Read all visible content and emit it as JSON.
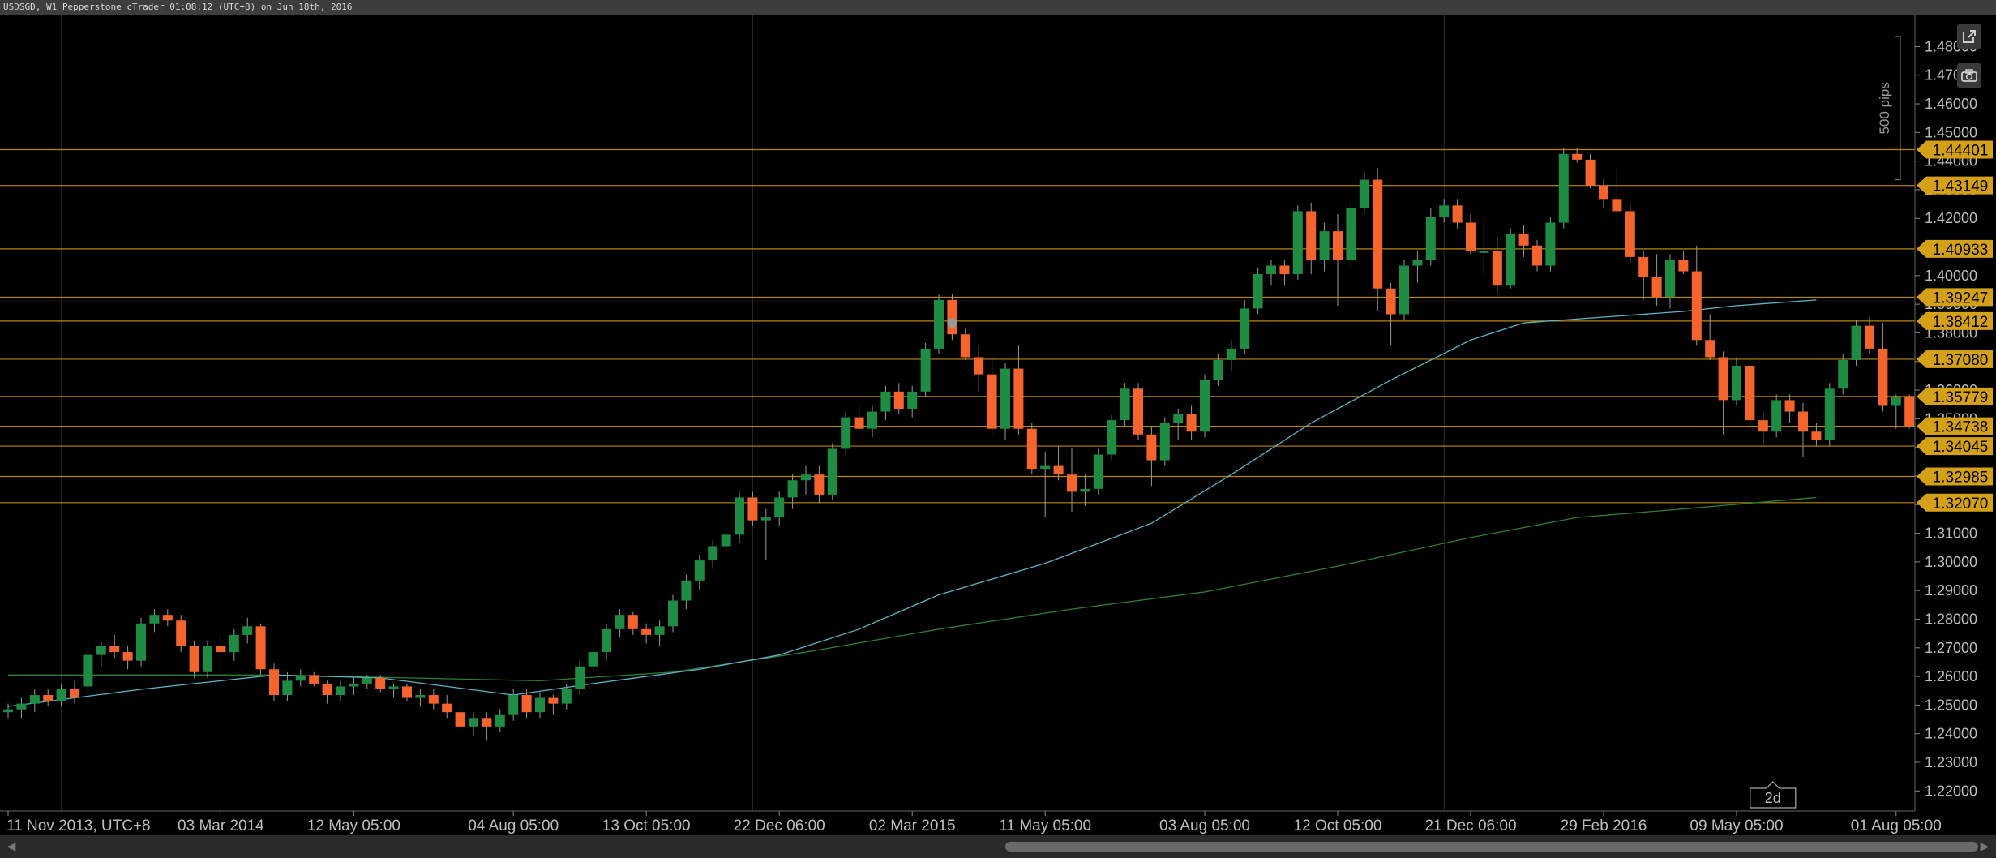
{
  "window": {
    "title": "USDSGD, W1 Pepperstone cTrader 01:08:12 (UTC+8) on Jun 18th, 2016"
  },
  "toolbar": {
    "detach_icon": "external-link-icon",
    "screenshot_icon": "camera-icon"
  },
  "colors": {
    "background": "#000000",
    "bull_candle": "#1e8c43",
    "bear_candle": "#f4642c",
    "horizontal_line": "#b8860b",
    "price_tag": "#d4a017",
    "ma_fast": "#5fb3c7",
    "ma_slow": "#2e7d32",
    "axis_text": "#bdbdbd"
  },
  "chart_data": {
    "type": "candlestick",
    "symbol": "USDSGD",
    "timeframe": "W1",
    "ylim": [
      1.213,
      1.4855
    ],
    "y_ticks": [
      1.22,
      1.23,
      1.24,
      1.25,
      1.26,
      1.27,
      1.28,
      1.29,
      1.3,
      1.31,
      1.32,
      1.33,
      1.34,
      1.35,
      1.36,
      1.37,
      1.38,
      1.39,
      1.4,
      1.41,
      1.42,
      1.43,
      1.44,
      1.45,
      1.46,
      1.47,
      1.48
    ],
    "y_tick_labels": [
      "1.22000",
      "1.23000",
      "1.24000",
      "1.25000",
      "1.26000",
      "1.27000",
      "1.28000",
      "1.29000",
      "1.30000",
      "1.31000",
      "1.32000",
      "1.33000",
      "1.34000",
      "1.35000",
      "1.36000",
      "1.37000",
      "1.38000",
      "1.39000",
      "1.40000",
      "1.41000",
      "1.42000",
      "1.43000",
      "1.44000",
      "1.45000",
      "1.46000",
      "1.47000",
      "1.48000"
    ],
    "x_labels": [
      {
        "index": 0,
        "label": "11 Nov 2013, UTC+8"
      },
      {
        "index": 16,
        "label": "03 Mar 2014"
      },
      {
        "index": 26,
        "label": "12 May 05:00"
      },
      {
        "index": 38,
        "label": "04 Aug 05:00"
      },
      {
        "index": 48,
        "label": "13 Oct 05:00"
      },
      {
        "index": 58,
        "label": "22 Dec 06:00"
      },
      {
        "index": 68,
        "label": "02 Mar 2015"
      },
      {
        "index": 78,
        "label": "11 May 05:00"
      },
      {
        "index": 90,
        "label": "03 Aug 05:00"
      },
      {
        "index": 100,
        "label": "12 Oct 05:00"
      },
      {
        "index": 110,
        "label": "21 Dec 06:00"
      },
      {
        "index": 120,
        "label": "29 Feb 2016"
      },
      {
        "index": 130,
        "label": "09 May 05:00"
      },
      {
        "index": 142,
        "label": "01 Aug 05:00"
      }
    ],
    "vertical_gridline_indices": [
      4,
      56,
      108
    ],
    "candles": [
      [
        1.2475,
        1.2505,
        1.2455,
        1.2485
      ],
      [
        1.2485,
        1.2525,
        1.2455,
        1.2505
      ],
      [
        1.2505,
        1.2555,
        1.2475,
        1.2535
      ],
      [
        1.2535,
        1.2555,
        1.2495,
        1.2515
      ],
      [
        1.2515,
        1.2575,
        1.2495,
        1.2555
      ],
      [
        1.2555,
        1.2585,
        1.2505,
        1.2525
      ],
      [
        1.2565,
        1.2695,
        1.2545,
        1.2675
      ],
      [
        1.2675,
        1.2725,
        1.2635,
        1.2705
      ],
      [
        1.2705,
        1.2745,
        1.2665,
        1.2685
      ],
      [
        1.2685,
        1.2705,
        1.2625,
        1.2655
      ],
      [
        1.2655,
        1.2805,
        1.2635,
        1.2785
      ],
      [
        1.2785,
        1.2835,
        1.2755,
        1.2815
      ],
      [
        1.2815,
        1.2835,
        1.2775,
        1.2795
      ],
      [
        1.2795,
        1.2815,
        1.2685,
        1.2705
      ],
      [
        1.2705,
        1.2725,
        1.2595,
        1.2615
      ],
      [
        1.2615,
        1.2725,
        1.2595,
        1.2705
      ],
      [
        1.2705,
        1.2745,
        1.2665,
        1.2685
      ],
      [
        1.2685,
        1.2765,
        1.2655,
        1.2745
      ],
      [
        1.2745,
        1.2805,
        1.2715,
        1.2775
      ],
      [
        1.2775,
        1.2785,
        1.2605,
        1.2625
      ],
      [
        1.2625,
        1.2645,
        1.2515,
        1.2535
      ],
      [
        1.2535,
        1.2615,
        1.2515,
        1.2585
      ],
      [
        1.2585,
        1.2625,
        1.2565,
        1.2605
      ],
      [
        1.2605,
        1.2615,
        1.2565,
        1.2575
      ],
      [
        1.2575,
        1.2585,
        1.2505,
        1.2535
      ],
      [
        1.2535,
        1.2585,
        1.2515,
        1.2565
      ],
      [
        1.2565,
        1.2595,
        1.2535,
        1.2575
      ],
      [
        1.2575,
        1.2605,
        1.2555,
        1.2595
      ],
      [
        1.2595,
        1.2605,
        1.2545,
        1.2555
      ],
      [
        1.2555,
        1.2575,
        1.2525,
        1.2565
      ],
      [
        1.2565,
        1.2575,
        1.2515,
        1.2525
      ],
      [
        1.2525,
        1.2555,
        1.2495,
        1.2535
      ],
      [
        1.2535,
        1.2555,
        1.2485,
        1.2505
      ],
      [
        1.2505,
        1.2535,
        1.2455,
        1.2475
      ],
      [
        1.2475,
        1.2495,
        1.2405,
        1.2425
      ],
      [
        1.2425,
        1.2475,
        1.2395,
        1.2455
      ],
      [
        1.2455,
        1.2475,
        1.2375,
        1.2425
      ],
      [
        1.2425,
        1.2485,
        1.2405,
        1.2465
      ],
      [
        1.2465,
        1.2555,
        1.2445,
        1.2535
      ],
      [
        1.2535,
        1.2555,
        1.2455,
        1.2475
      ],
      [
        1.2475,
        1.2545,
        1.2455,
        1.2525
      ],
      [
        1.2525,
        1.2535,
        1.2465,
        1.2505
      ],
      [
        1.2505,
        1.2575,
        1.2485,
        1.2555
      ],
      [
        1.2555,
        1.2655,
        1.2535,
        1.2635
      ],
      [
        1.2635,
        1.2705,
        1.2615,
        1.2685
      ],
      [
        1.2685,
        1.2785,
        1.2655,
        1.2765
      ],
      [
        1.2765,
        1.2835,
        1.2735,
        1.2815
      ],
      [
        1.2815,
        1.2825,
        1.2745,
        1.2765
      ],
      [
        1.2765,
        1.2785,
        1.2715,
        1.2745
      ],
      [
        1.2745,
        1.2795,
        1.2705,
        1.2775
      ],
      [
        1.2775,
        1.2885,
        1.2755,
        1.2865
      ],
      [
        1.2865,
        1.2955,
        1.2835,
        1.2935
      ],
      [
        1.2935,
        1.3025,
        1.2905,
        1.3005
      ],
      [
        1.3005,
        1.3075,
        1.2975,
        1.3055
      ],
      [
        1.3055,
        1.3125,
        1.3025,
        1.3095
      ],
      [
        1.3095,
        1.3245,
        1.3065,
        1.3225
      ],
      [
        1.3225,
        1.3245,
        1.3125,
        1.3145
      ],
      [
        1.3145,
        1.3185,
        1.3005,
        1.3155
      ],
      [
        1.3155,
        1.3245,
        1.3125,
        1.3225
      ],
      [
        1.3225,
        1.3305,
        1.3185,
        1.3285
      ],
      [
        1.3285,
        1.3335,
        1.3235,
        1.3305
      ],
      [
        1.3305,
        1.3335,
        1.3205,
        1.3235
      ],
      [
        1.3235,
        1.3415,
        1.3215,
        1.3395
      ],
      [
        1.3395,
        1.3525,
        1.3375,
        1.3505
      ],
      [
        1.3505,
        1.3555,
        1.3445,
        1.3465
      ],
      [
        1.3465,
        1.3545,
        1.3435,
        1.3525
      ],
      [
        1.3525,
        1.3615,
        1.3495,
        1.3595
      ],
      [
        1.3595,
        1.3625,
        1.3515,
        1.3535
      ],
      [
        1.3535,
        1.3615,
        1.3505,
        1.3595
      ],
      [
        1.3595,
        1.3765,
        1.3575,
        1.3745
      ],
      [
        1.3745,
        1.3935,
        1.3725,
        1.3915
      ],
      [
        1.3915,
        1.3935,
        1.3775,
        1.3795
      ],
      [
        1.3795,
        1.3815,
        1.3705,
        1.3715
      ],
      [
        1.3715,
        1.3755,
        1.3595,
        1.3655
      ],
      [
        1.3655,
        1.3715,
        1.3445,
        1.3465
      ],
      [
        1.3465,
        1.3695,
        1.3425,
        1.3675
      ],
      [
        1.3675,
        1.3755,
        1.3445,
        1.3465
      ],
      [
        1.3465,
        1.3485,
        1.3305,
        1.3325
      ],
      [
        1.3325,
        1.3385,
        1.3155,
        1.3335
      ],
      [
        1.3335,
        1.3405,
        1.3285,
        1.3305
      ],
      [
        1.3305,
        1.3395,
        1.3175,
        1.3245
      ],
      [
        1.3245,
        1.3305,
        1.3195,
        1.3255
      ],
      [
        1.3255,
        1.3395,
        1.3235,
        1.3375
      ],
      [
        1.3375,
        1.3515,
        1.3355,
        1.3495
      ],
      [
        1.3495,
        1.3625,
        1.3475,
        1.3605
      ],
      [
        1.3605,
        1.3625,
        1.3425,
        1.3445
      ],
      [
        1.3445,
        1.3475,
        1.3265,
        1.3355
      ],
      [
        1.3355,
        1.3505,
        1.3335,
        1.3485
      ],
      [
        1.3485,
        1.3535,
        1.3425,
        1.3515
      ],
      [
        1.3515,
        1.3545,
        1.3425,
        1.3455
      ],
      [
        1.3455,
        1.3655,
        1.3435,
        1.3635
      ],
      [
        1.3635,
        1.3725,
        1.3615,
        1.3705
      ],
      [
        1.3705,
        1.3775,
        1.3665,
        1.3745
      ],
      [
        1.3745,
        1.3915,
        1.3725,
        1.3885
      ],
      [
        1.3885,
        1.4025,
        1.3865,
        1.4005
      ],
      [
        1.4005,
        1.4055,
        1.3965,
        1.4035
      ],
      [
        1.4035,
        1.4055,
        1.3965,
        1.4005
      ],
      [
        1.4005,
        1.4245,
        1.3985,
        1.4225
      ],
      [
        1.4225,
        1.4255,
        1.4005,
        1.4055
      ],
      [
        1.4055,
        1.4185,
        1.4015,
        1.4155
      ],
      [
        1.4155,
        1.4215,
        1.3895,
        1.4055
      ],
      [
        1.4055,
        1.4255,
        1.4025,
        1.4235
      ],
      [
        1.4235,
        1.4365,
        1.4215,
        1.4335
      ],
      [
        1.4335,
        1.4375,
        1.3875,
        1.3955
      ],
      [
        1.3955,
        1.3975,
        1.3755,
        1.3865
      ],
      [
        1.3865,
        1.4055,
        1.3845,
        1.4035
      ],
      [
        1.4035,
        1.4085,
        1.3975,
        1.4055
      ],
      [
        1.4055,
        1.4235,
        1.4035,
        1.4205
      ],
      [
        1.4205,
        1.4265,
        1.4185,
        1.4245
      ],
      [
        1.4245,
        1.4265,
        1.4165,
        1.4185
      ],
      [
        1.4185,
        1.4215,
        1.4075,
        1.4085
      ],
      [
        1.4085,
        1.4205,
        1.4005,
        1.4085
      ],
      [
        1.4085,
        1.4135,
        1.3935,
        1.3965
      ],
      [
        1.3965,
        1.4165,
        1.3955,
        1.4145
      ],
      [
        1.4145,
        1.4175,
        1.4065,
        1.4105
      ],
      [
        1.4105,
        1.4125,
        1.4015,
        1.4035
      ],
      [
        1.4035,
        1.4205,
        1.4015,
        1.4185
      ],
      [
        1.4185,
        1.4445,
        1.4165,
        1.4425
      ],
      [
        1.4425,
        1.4445,
        1.4395,
        1.4405
      ],
      [
        1.4405,
        1.4425,
        1.4305,
        1.4315
      ],
      [
        1.4315,
        1.4335,
        1.4235,
        1.4265
      ],
      [
        1.4265,
        1.4375,
        1.4195,
        1.4225
      ],
      [
        1.4225,
        1.4245,
        1.4045,
        1.4065
      ],
      [
        1.4065,
        1.4085,
        1.3915,
        1.3995
      ],
      [
        1.3995,
        1.4075,
        1.3895,
        1.3925
      ],
      [
        1.3925,
        1.4075,
        1.3885,
        1.4055
      ],
      [
        1.4055,
        1.4085,
        1.4005,
        1.4015
      ],
      [
        1.4015,
        1.4105,
        1.3755,
        1.3775
      ],
      [
        1.3775,
        1.3865,
        1.3705,
        1.3715
      ],
      [
        1.3715,
        1.3735,
        1.3445,
        1.3565
      ],
      [
        1.3565,
        1.3715,
        1.3545,
        1.3685
      ],
      [
        1.3685,
        1.3705,
        1.3465,
        1.3495
      ],
      [
        1.3495,
        1.3525,
        1.3405,
        1.3455
      ],
      [
        1.3455,
        1.3585,
        1.3435,
        1.3565
      ],
      [
        1.3565,
        1.3585,
        1.3485,
        1.3525
      ],
      [
        1.3525,
        1.3555,
        1.3365,
        1.3455
      ],
      [
        1.3455,
        1.3485,
        1.3405,
        1.3425
      ],
      [
        1.3425,
        1.3625,
        1.3405,
        1.3605
      ],
      [
        1.3605,
        1.3725,
        1.3585,
        1.3705
      ],
      [
        1.3705,
        1.3845,
        1.3685,
        1.3825
      ],
      [
        1.3825,
        1.3855,
        1.3725,
        1.3745
      ],
      [
        1.3745,
        1.3835,
        1.3525,
        1.3545
      ],
      [
        1.3545,
        1.3585,
        1.3465,
        1.3575
      ],
      [
        1.3575,
        1.3585,
        1.3465,
        1.3475
      ]
    ],
    "ma_fast": [
      [
        0,
        1.2495
      ],
      [
        10,
        1.2555
      ],
      [
        20,
        1.2605
      ],
      [
        28,
        1.2595
      ],
      [
        38,
        1.2535
      ],
      [
        44,
        1.2575
      ],
      [
        52,
        1.2625
      ],
      [
        58,
        1.2675
      ],
      [
        64,
        1.2765
      ],
      [
        70,
        1.2885
      ],
      [
        78,
        1.2995
      ],
      [
        86,
        1.3135
      ],
      [
        92,
        1.3305
      ],
      [
        98,
        1.3485
      ],
      [
        104,
        1.3635
      ],
      [
        110,
        1.3775
      ],
      [
        114,
        1.3835
      ],
      [
        120,
        1.3855
      ],
      [
        126,
        1.3875
      ],
      [
        130,
        1.3895
      ],
      [
        136,
        1.3915
      ]
    ],
    "ma_slow": [
      [
        0,
        1.2605
      ],
      [
        20,
        1.2605
      ],
      [
        40,
        1.2585
      ],
      [
        50,
        1.2615
      ],
      [
        60,
        1.2685
      ],
      [
        70,
        1.2765
      ],
      [
        80,
        1.2835
      ],
      [
        90,
        1.2895
      ],
      [
        100,
        1.2985
      ],
      [
        110,
        1.3085
      ],
      [
        118,
        1.3155
      ],
      [
        126,
        1.3185
      ],
      [
        136,
        1.3225
      ]
    ],
    "horizontal_levels": [
      {
        "price": 1.44401,
        "label": "1.44401"
      },
      {
        "price": 1.43149,
        "label": "1.43149"
      },
      {
        "price": 1.40933,
        "label": "1.40933"
      },
      {
        "price": 1.39247,
        "label": "1.39247"
      },
      {
        "price": 1.38412,
        "label": "1.38412"
      },
      {
        "price": 1.3708,
        "label": "1.37080"
      },
      {
        "price": 1.35779,
        "label": "1.35779"
      },
      {
        "price": 1.34738,
        "label": "1.34738"
      },
      {
        "price": 1.34045,
        "label": "1.34045"
      },
      {
        "price": 1.32985,
        "label": "1.32985"
      },
      {
        "price": 1.3207,
        "label": "1.32070"
      }
    ],
    "marker_point": {
      "index": 71,
      "price": 1.3835
    },
    "pip_ruler": {
      "label": "500 pips",
      "from": 1.4335,
      "to": 1.4835
    },
    "zoom_badge": {
      "label": "2d",
      "index": 132
    }
  }
}
